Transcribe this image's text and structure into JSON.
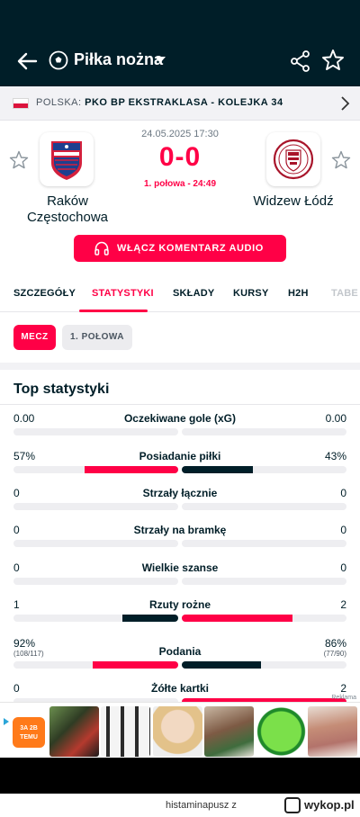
{
  "app": {
    "title": "Piłka nożna",
    "icons": [
      "back-arrow-icon",
      "football-icon",
      "dropdown-caret-icon",
      "share-icon",
      "star-outline-icon"
    ]
  },
  "league": {
    "country": "POLSKA:",
    "competition": "PKO BP EKSTRAKLASA - KOLEJKA 34"
  },
  "match": {
    "home_team": "Raków\nCzęstochowa",
    "away_team": "Widzew Łódź",
    "date": "24.05.2025 17:30",
    "score": "0-0",
    "period": "1. połowa - 24:49",
    "audio_button": "WŁĄCZ KOMENTARZ AUDIO"
  },
  "tabs": [
    "SZCZEGÓŁY",
    "STATYSTYKI",
    "SKŁADY",
    "KURSY",
    "H2H",
    "TABE"
  ],
  "filters": {
    "match": "MECZ",
    "half": "1. POŁOWA"
  },
  "stats_title": "Top statystyki",
  "colors": {
    "accent": "#ff0046",
    "dark": "#001e28",
    "track": "#eeeef1"
  },
  "stats": [
    {
      "name": "Oczekiwane gole (xG)",
      "home": "0.00",
      "away": "0.00",
      "home_share": 0,
      "away_share": 0
    },
    {
      "name": "Posiadanie piłki",
      "home": "57%",
      "away": "43%",
      "home_share": 0.57,
      "away_share": 0.43,
      "winner": "home"
    },
    {
      "name": "Strzały łącznie",
      "home": "0",
      "away": "0",
      "home_share": 0,
      "away_share": 0
    },
    {
      "name": "Strzały na bramkę",
      "home": "0",
      "away": "0",
      "home_share": 0,
      "away_share": 0
    },
    {
      "name": "Wielkie szanse",
      "home": "0",
      "away": "0",
      "home_share": 0,
      "away_share": 0
    },
    {
      "name": "Rzuty rożne",
      "home": "1",
      "away": "2",
      "home_share": 0.34,
      "away_share": 0.67,
      "winner": "away"
    },
    {
      "name": "Podania",
      "home": "92%",
      "away": "86%",
      "home_sub": "(108/117)",
      "away_sub": "(77/90)",
      "home_share": 0.52,
      "away_share": 0.48,
      "winner": "home"
    },
    {
      "name": "Żółte kartki",
      "home": "0",
      "away": "2",
      "home_share": 0,
      "away_share": 1,
      "winner": "away"
    }
  ],
  "ad": {
    "label": "Reklama",
    "brand": "TEMU",
    "brand_logo_text": "3A 2B TEMU"
  },
  "footer": {
    "username": "histaminapusz z",
    "site": "wykop.pl"
  }
}
